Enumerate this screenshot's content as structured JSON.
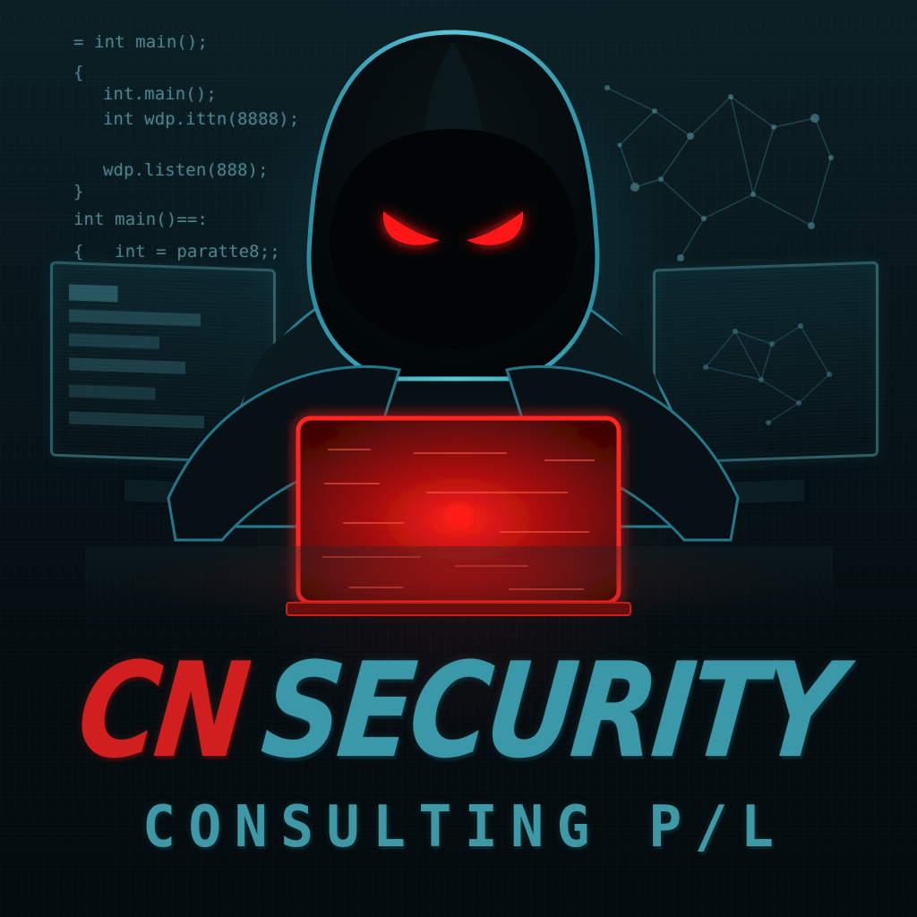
{
  "background": {
    "code_lines": [
      "= int main();",
      "{",
      "int.main();",
      "int wdp.ittn(8888);",
      "wdp.listen(888);",
      "}",
      "int main()==:",
      "{   int = paratte8;;"
    ]
  },
  "brand": {
    "name_part_1": "CN",
    "name_part_2": "SECURITY",
    "subtitle": "CONSULTING P/L"
  },
  "colors": {
    "background_primary": "#071217",
    "accent_red": "#d11e1e",
    "accent_teal": "#3a98a8",
    "hood_shadow": "#050b0e"
  },
  "icons": {
    "hooded_figure": "hooded-hacker-figure-icon",
    "laptop": "red-laptop-icon",
    "network": "network-graph-icon"
  }
}
